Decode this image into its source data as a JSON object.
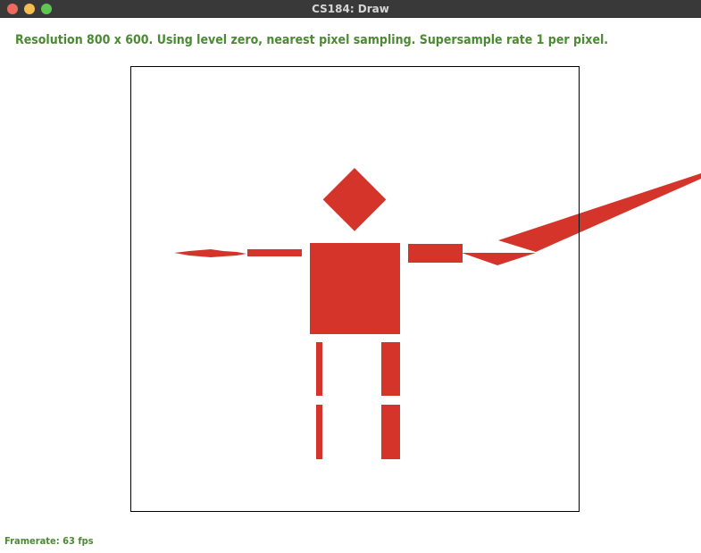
{
  "window": {
    "title": "CS184: Draw",
    "controls": {
      "close_color": "#ed6a5e",
      "minimize_color": "#f5bf4f",
      "zoom_color": "#61c554"
    }
  },
  "status": {
    "text": "Resolution 800 x 600. Using level zero, nearest pixel sampling. Supersample rate 1 per pixel.",
    "color": "#4a8a32"
  },
  "footer": {
    "framerate_text": "Framerate: 63 fps"
  },
  "scene": {
    "shape_color": "#d4342a",
    "frame_color": "#000000"
  }
}
